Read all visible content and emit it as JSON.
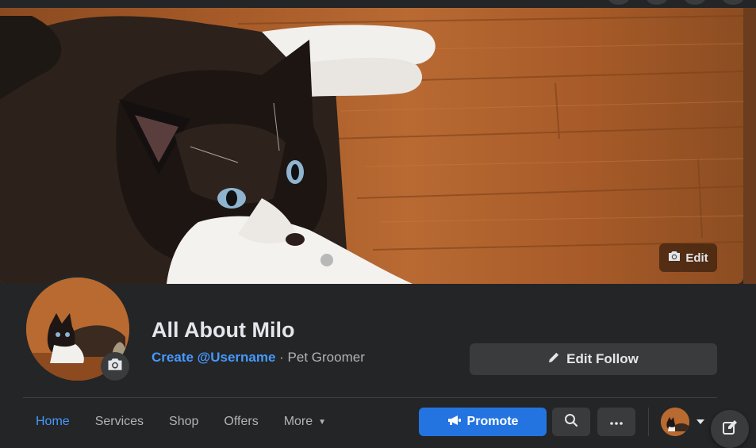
{
  "cover": {
    "edit_label": "Edit",
    "edit_icon": "camera-icon"
  },
  "profile": {
    "avatar_camera_icon": "camera-icon",
    "name": "All About Milo",
    "username_link": "Create @Username",
    "separator": " · ",
    "category": "Pet Groomer"
  },
  "actions": {
    "edit_follow_label": "Edit Follow",
    "edit_follow_icon": "pencil-icon"
  },
  "tabs": [
    {
      "label": "Home",
      "active": true
    },
    {
      "label": "Services",
      "active": false
    },
    {
      "label": "Shop",
      "active": false
    },
    {
      "label": "Offers",
      "active": false
    },
    {
      "label": "More",
      "active": false
    }
  ],
  "toolbar": {
    "promote_label": "Promote",
    "promote_icon": "megaphone-icon",
    "search_icon": "search-icon",
    "more_icon": "ellipsis-icon",
    "account_caret_icon": "caret-down-icon",
    "compose_icon": "compose-icon"
  },
  "colors": {
    "background": "#242526",
    "accent": "#4599ff",
    "primary_button": "#2374e1",
    "secondary_button": "#3a3b3c"
  }
}
